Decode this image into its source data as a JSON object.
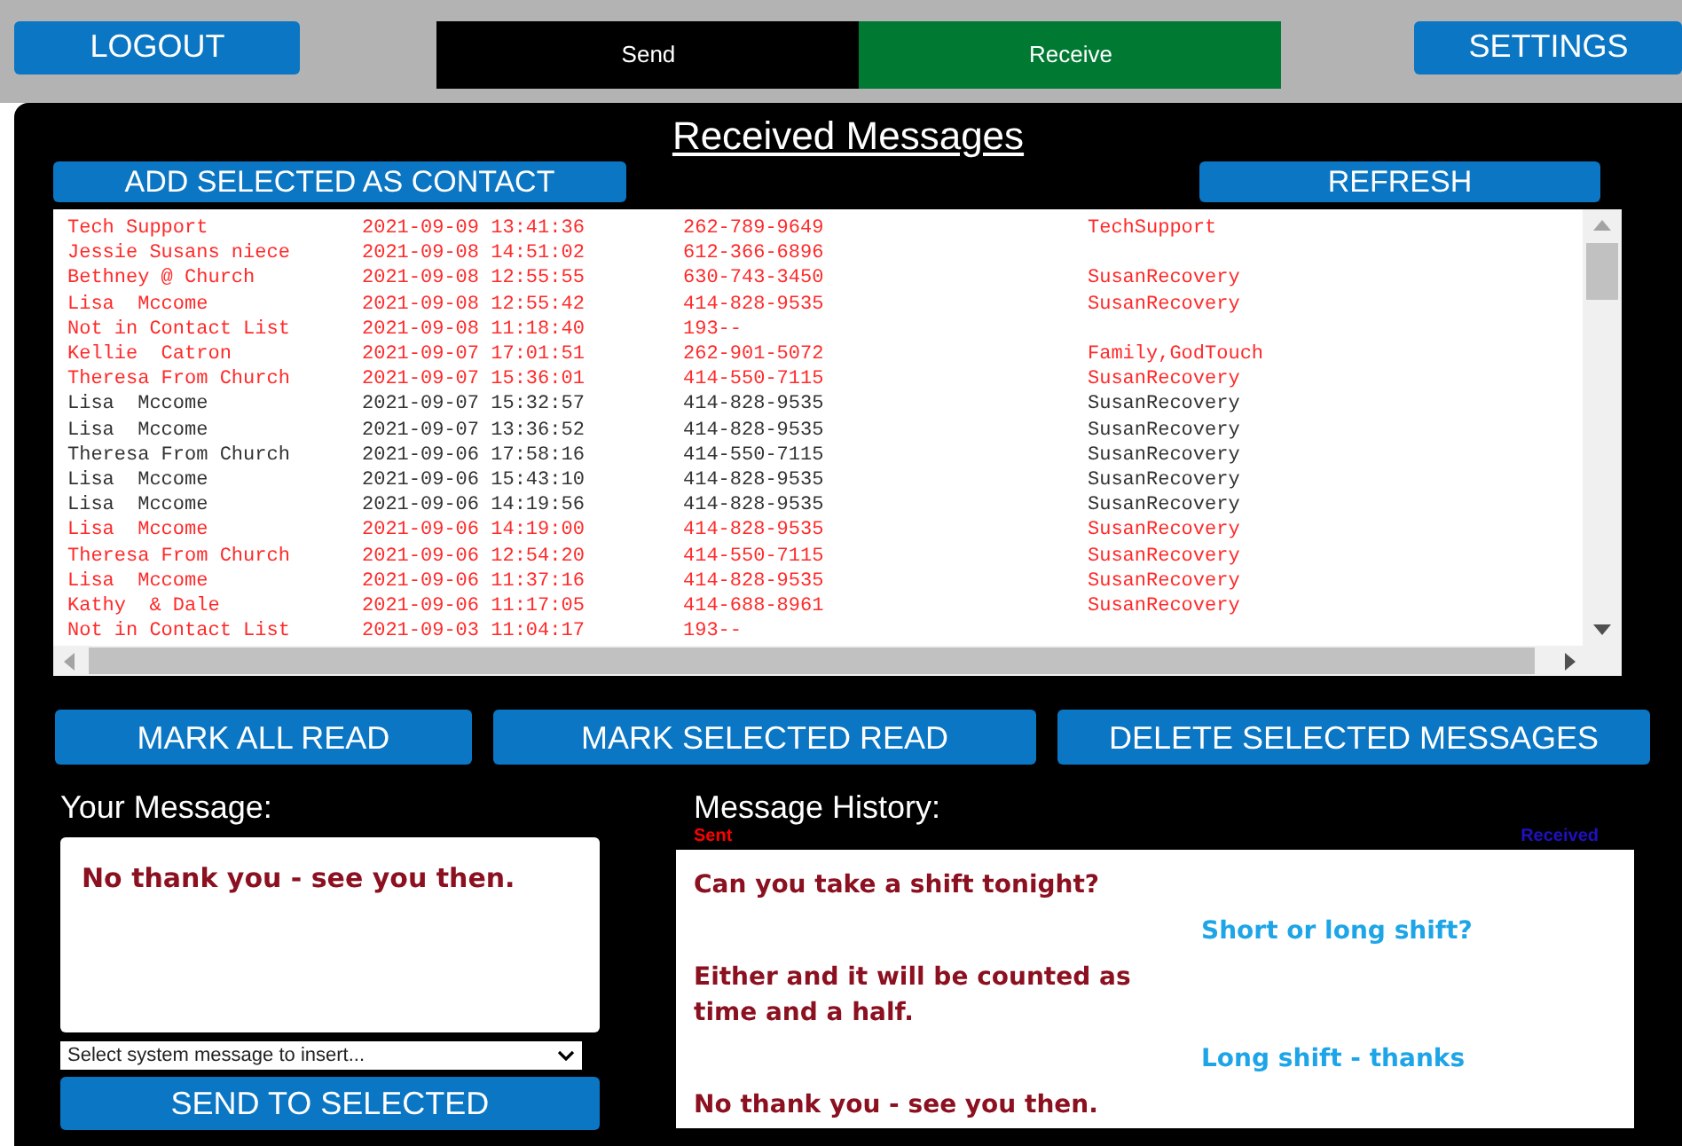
{
  "top_bar": {
    "logout": "LOGOUT",
    "settings": "SETTINGS",
    "tabs": [
      {
        "label": "Send",
        "selected": false
      },
      {
        "label": "Receive",
        "selected": true
      }
    ]
  },
  "received": {
    "title": "Received Messages",
    "add_contact": "ADD SELECTED AS CONTACT",
    "refresh": "REFRESH",
    "rows": [
      {
        "name": "Tech Support",
        "time": "2021-09-09 13:41:36",
        "phone": "262-789-9649",
        "groups": "TechSupport",
        "unread": true
      },
      {
        "name": "Jessie Susans niece",
        "time": "2021-09-08 14:51:02",
        "phone": "612-366-6896",
        "unread": true
      },
      {
        "name": "Bethney @ Church",
        "time": "2021-09-08 12:55:55",
        "phone": "630-743-3450",
        "groups": "SusanRecovery",
        "unread": true
      },
      {
        "name": "Lisa  Mccome",
        "time": "2021-09-08 12:55:42",
        "phone": "414-828-9535",
        "groups": "SusanRecovery",
        "unread": true
      },
      {
        "name": "Not in Contact List",
        "time": "2021-09-08 11:18:40",
        "phone": "193--",
        "unread": true
      },
      {
        "name": "Kellie  Catron",
        "time": "2021-09-07 17:01:51",
        "phone": "262-901-5072",
        "groups": "Family,GodTouch",
        "unread": true
      },
      {
        "name": "Theresa From Church",
        "time": "2021-09-07 15:36:01",
        "phone": "414-550-7115",
        "groups": "SusanRecovery",
        "unread": true
      },
      {
        "name": "Lisa  Mccome",
        "time": "2021-09-07 15:32:57",
        "phone": "414-828-9535",
        "groups": "SusanRecovery",
        "unread": false
      },
      {
        "name": "Lisa  Mccome",
        "time": "2021-09-07 13:36:52",
        "phone": "414-828-9535",
        "groups": "SusanRecovery",
        "unread": false
      },
      {
        "name": "Theresa From Church",
        "time": "2021-09-06 17:58:16",
        "phone": "414-550-7115",
        "groups": "SusanRecovery",
        "unread": false
      },
      {
        "name": "Lisa  Mccome",
        "time": "2021-09-06 15:43:10",
        "phone": "414-828-9535",
        "groups": "SusanRecovery",
        "unread": false
      },
      {
        "name": "Lisa  Mccome",
        "time": "2021-09-06 14:19:56",
        "phone": "414-828-9535",
        "groups": "SusanRecovery",
        "unread": false
      },
      {
        "name": "Lisa  Mccome",
        "time": "2021-09-06 14:19:00",
        "phone": "414-828-9535",
        "groups": "SusanRecovery",
        "unread": true
      },
      {
        "name": "Theresa From Church",
        "time": "2021-09-06 12:54:20",
        "phone": "414-550-7115",
        "groups": "SusanRecovery",
        "unread": true
      },
      {
        "name": "Lisa  Mccome",
        "time": "2021-09-06 11:37:16",
        "phone": "414-828-9535",
        "groups": "SusanRecovery",
        "unread": true
      },
      {
        "name": "Kathy  & Dale",
        "time": "2021-09-06 11:17:05",
        "phone": "414-688-8961",
        "groups": "SusanRecovery",
        "unread": true
      },
      {
        "name": "Not in Contact List",
        "time": "2021-09-03 11:04:17",
        "phone": "193--",
        "unread": true
      }
    ],
    "actions": [
      "MARK ALL READ",
      "MARK SELECTED READ",
      "DELETE SELECTED MESSAGES"
    ]
  },
  "compose": {
    "label": "Your Message:",
    "value": "No thank you - see you then.",
    "select_placeholder": "Select system message to insert...",
    "send": "SEND TO SELECTED"
  },
  "history": {
    "label": "Message History:",
    "sent_label": "Sent",
    "received_label": "Received",
    "messages": [
      {
        "kind": "sent",
        "text": "Can you take a shift tonight?"
      },
      {
        "kind": "received",
        "text": "Short or long shift?"
      },
      {
        "kind": "sent",
        "text": "Either and it will be counted as time and a half."
      },
      {
        "kind": "received",
        "text": "Long shift - thanks"
      },
      {
        "kind": "sent",
        "text": "No thank you - see you then."
      }
    ]
  }
}
